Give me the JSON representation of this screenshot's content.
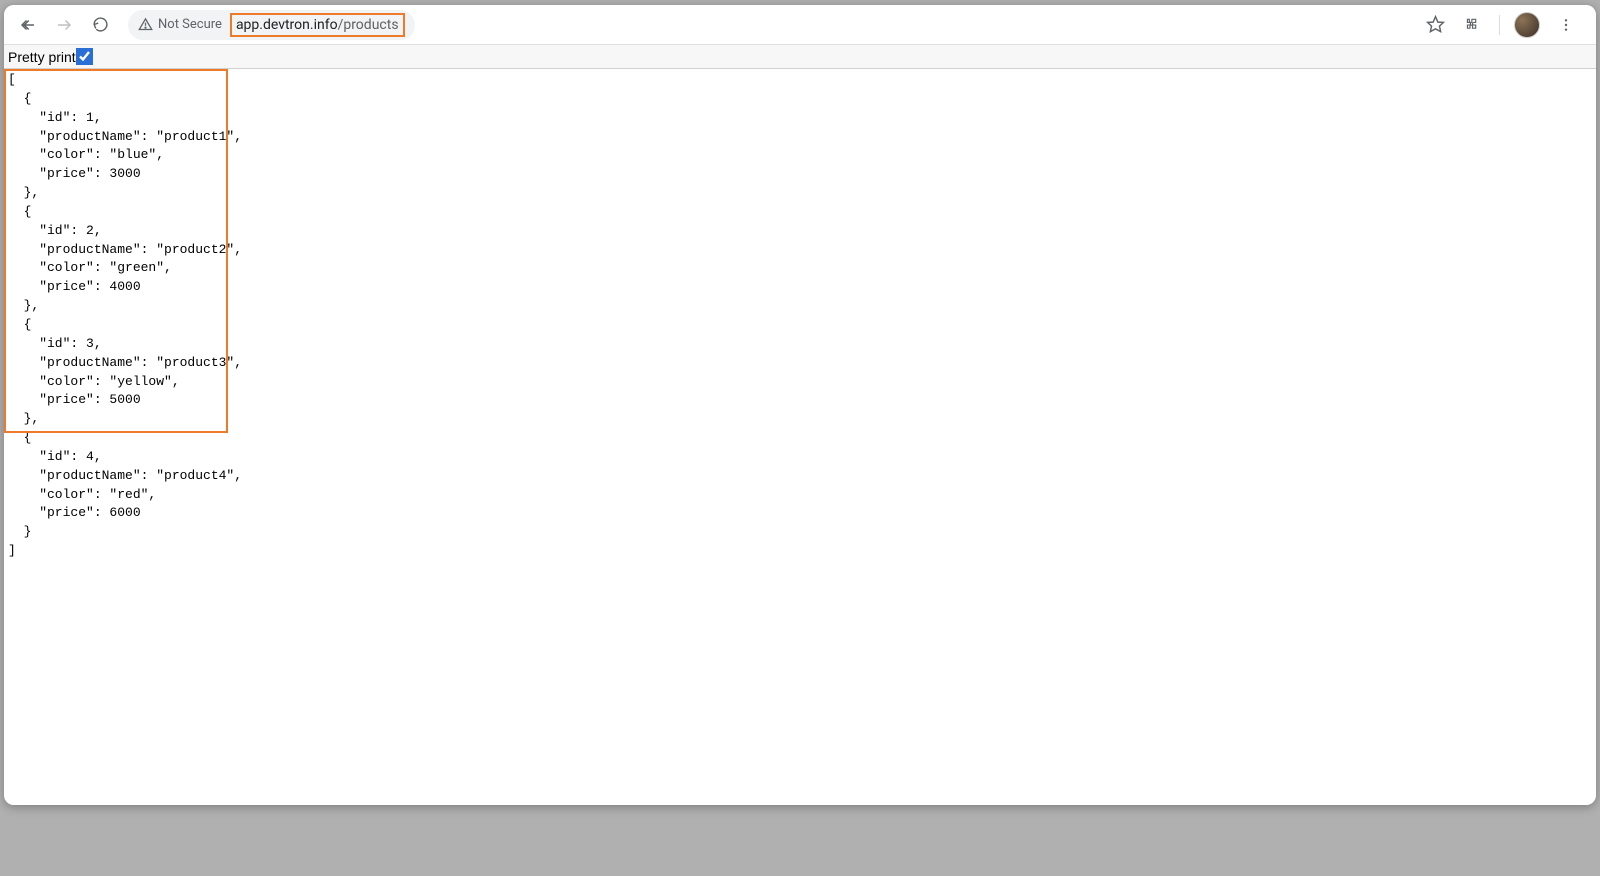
{
  "toolbar": {
    "not_secure_label": "Not Secure",
    "url_domain": "app.devtron.info",
    "url_path": "/products"
  },
  "pretty_print": {
    "label": "Pretty print",
    "checked": true
  },
  "json_response": [
    {
      "id": 1,
      "productName": "product1",
      "color": "blue",
      "price": 3000
    },
    {
      "id": 2,
      "productName": "product2",
      "color": "green",
      "price": 4000
    },
    {
      "id": 3,
      "productName": "product3",
      "color": "yellow",
      "price": 5000
    },
    {
      "id": 4,
      "productName": "product4",
      "color": "red",
      "price": 6000
    }
  ]
}
